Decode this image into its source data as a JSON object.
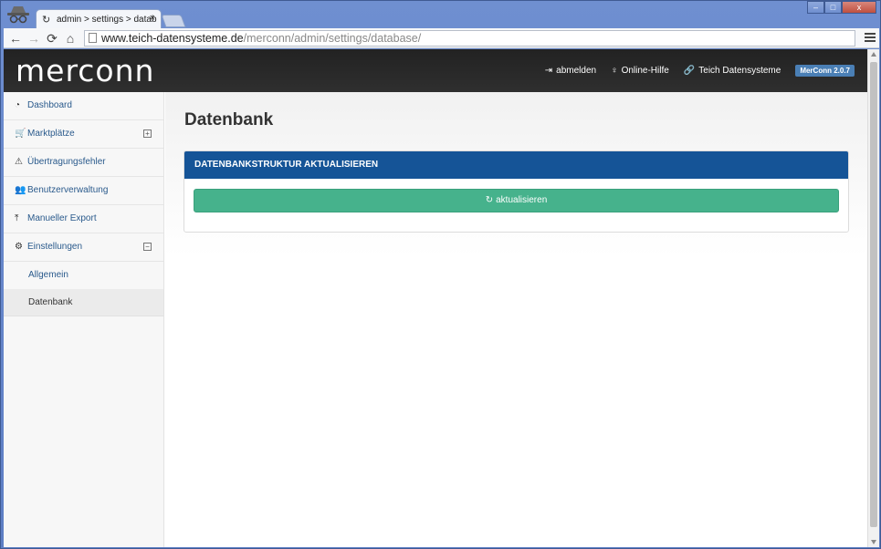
{
  "browser": {
    "tab_title": "admin > settings > datab",
    "tab_close": "×",
    "url_host": "www.teich-datensysteme.de",
    "url_path": "/merconn/admin/settings/database/",
    "nav": {
      "back": "←",
      "forward": "→",
      "reload": "⟳",
      "home": "⌂"
    },
    "window_buttons": {
      "minimize": "–",
      "maximize": "□",
      "close": "x"
    }
  },
  "header": {
    "logo": "merconn",
    "links": [
      {
        "label": "abmelden",
        "icon": "logout-icon",
        "glyph": "⇥"
      },
      {
        "label": "Online-Hilfe",
        "icon": "lightbulb-icon",
        "glyph": "♀"
      },
      {
        "label": "Teich Datensysteme",
        "icon": "link-icon",
        "glyph": "🔗"
      }
    ],
    "version": "MerConn 2.0.7"
  },
  "sidebar": {
    "items": [
      {
        "label": "Dashboard",
        "icon": "dashboard-icon",
        "glyph": "◔"
      },
      {
        "label": "Marktplätze",
        "icon": "cart-icon",
        "glyph": "🛒",
        "toggle": "+"
      },
      {
        "label": "Übertragungsfehler",
        "icon": "warning-icon",
        "glyph": "⚠"
      },
      {
        "label": "Benutzerverwaltung",
        "icon": "users-icon",
        "glyph": "👥"
      },
      {
        "label": "Manueller Export",
        "icon": "upload-icon",
        "glyph": "⤒"
      },
      {
        "label": "Einstellungen",
        "icon": "gears-icon",
        "glyph": "⚙",
        "toggle": "−"
      }
    ],
    "subitems": [
      {
        "label": "Allgemein"
      },
      {
        "label": "Datenbank"
      }
    ]
  },
  "main": {
    "title": "Datenbank",
    "panel_title": "DATENBANKSTRUKTUR AKTUALISIEREN",
    "button_label": "aktualisieren",
    "button_glyph": "↻"
  },
  "colors": {
    "header_bg": "#2a2a2a",
    "panel_head": "#155497",
    "button": "#46b28c",
    "version_badge": "#4a7fb5",
    "link": "#2a5a8c"
  }
}
